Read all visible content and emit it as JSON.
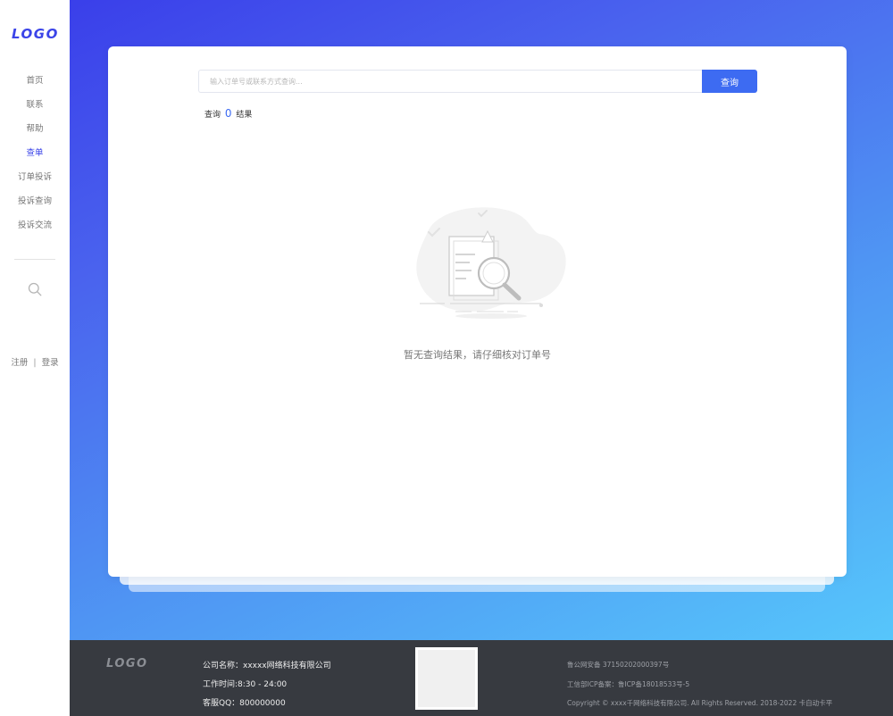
{
  "sidebar": {
    "logo": "LOGO",
    "nav": [
      {
        "label": "首页",
        "active": false
      },
      {
        "label": "联系",
        "active": false
      },
      {
        "label": "帮助",
        "active": false
      },
      {
        "label": "查单",
        "active": true
      },
      {
        "label": "订单投诉",
        "active": false
      },
      {
        "label": "投诉查询",
        "active": false
      },
      {
        "label": "投诉交流",
        "active": false
      }
    ],
    "search_icon": "search-icon",
    "register_label": "注册",
    "divider": "|",
    "login_label": "登录"
  },
  "query": {
    "placeholder": "输入订单号或联系方式查询...",
    "button_label": "查询",
    "result_prefix": "查询",
    "result_count": "0",
    "result_suffix": "结果",
    "empty_text": "暂无查询结果，请仔细核对订单号"
  },
  "footer": {
    "logo": "LOGO",
    "company": "公司名称：xxxxx网络科技有限公司",
    "hours": "工作时间:8:30 - 24:00",
    "qq": "客服QQ：800000000",
    "police_record": "鲁公网安备 37150202000397号",
    "icp_record": "工信部ICP备案：鲁ICP备18018533号-5",
    "copyright": "Copyright © xxxx千网络科技有限公司. All Rights Reserved. 2018-2022 卡自动卡平"
  },
  "colors": {
    "accent": "#3d6bf2",
    "sidebar_active": "#3b44e8",
    "footer_bg": "#373a40"
  }
}
